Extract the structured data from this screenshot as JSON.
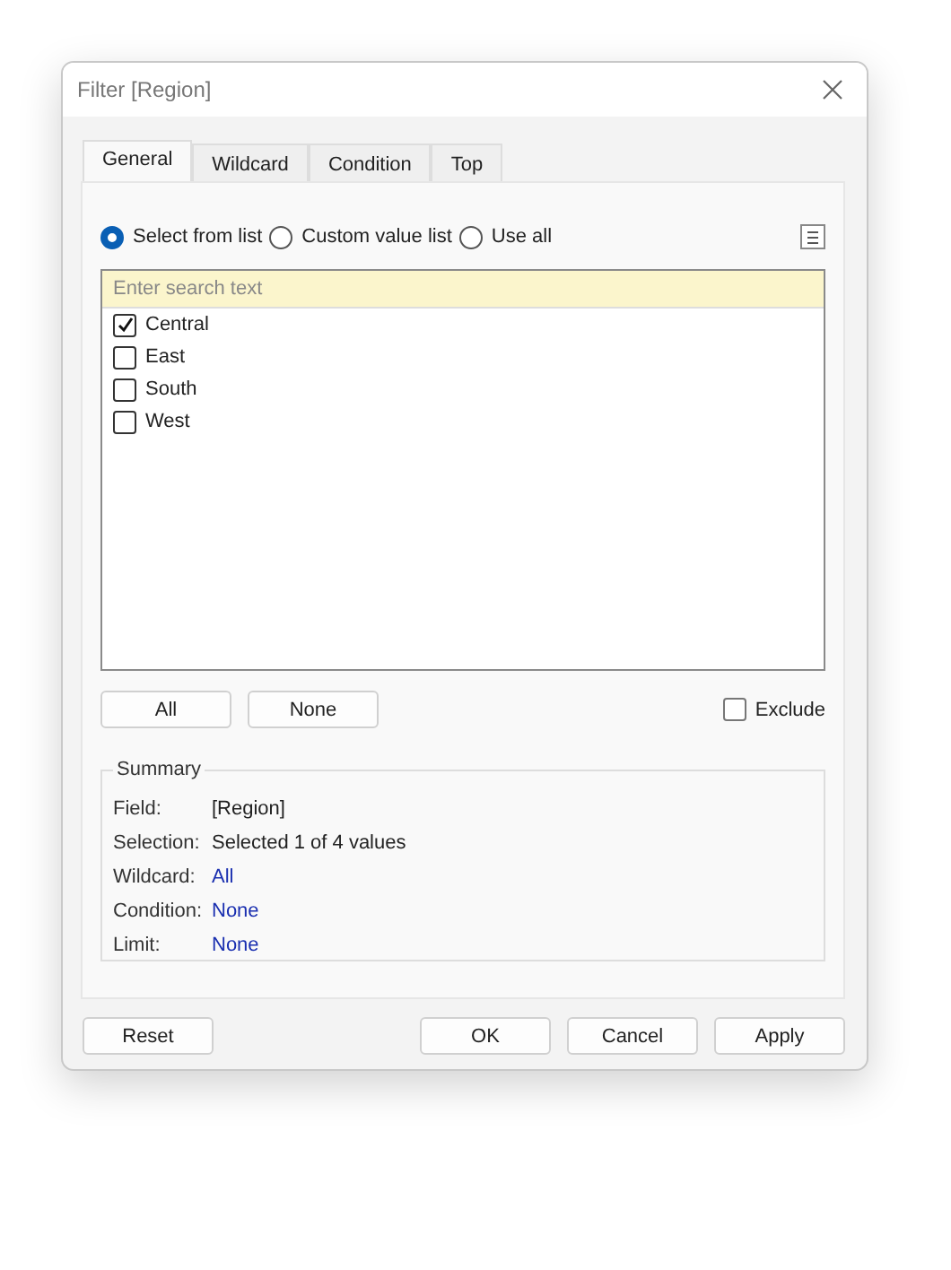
{
  "window": {
    "title": "Filter [Region]"
  },
  "tabs": [
    {
      "label": "General",
      "selected": true
    },
    {
      "label": "Wildcard",
      "selected": false
    },
    {
      "label": "Condition",
      "selected": false
    },
    {
      "label": "Top",
      "selected": false
    }
  ],
  "modes": [
    {
      "label": "Select from list",
      "selected": true
    },
    {
      "label": "Custom value list",
      "selected": false
    },
    {
      "label": "Use all",
      "selected": false
    }
  ],
  "search": {
    "placeholder": "Enter search text"
  },
  "values": [
    {
      "label": "Central",
      "checked": true
    },
    {
      "label": "East",
      "checked": false
    },
    {
      "label": "South",
      "checked": false
    },
    {
      "label": "West",
      "checked": false
    }
  ],
  "list_buttons": [
    "All",
    "None"
  ],
  "exclude": {
    "label": "Exclude",
    "checked": false
  },
  "summary": {
    "title": "Summary",
    "rows": [
      {
        "label": "Field:",
        "value": "[Region]",
        "kind": "text"
      },
      {
        "label": "Selection:",
        "value": "Selected 1 of 4 values",
        "kind": "text"
      },
      {
        "label": "Wildcard:",
        "value": "All",
        "kind": "link"
      },
      {
        "label": "Condition:",
        "value": "None",
        "kind": "link"
      },
      {
        "label": "Limit:",
        "value": "None",
        "kind": "link"
      }
    ]
  },
  "footer": {
    "left": [
      "Reset"
    ],
    "right": [
      "OK",
      "Cancel",
      "Apply"
    ]
  }
}
